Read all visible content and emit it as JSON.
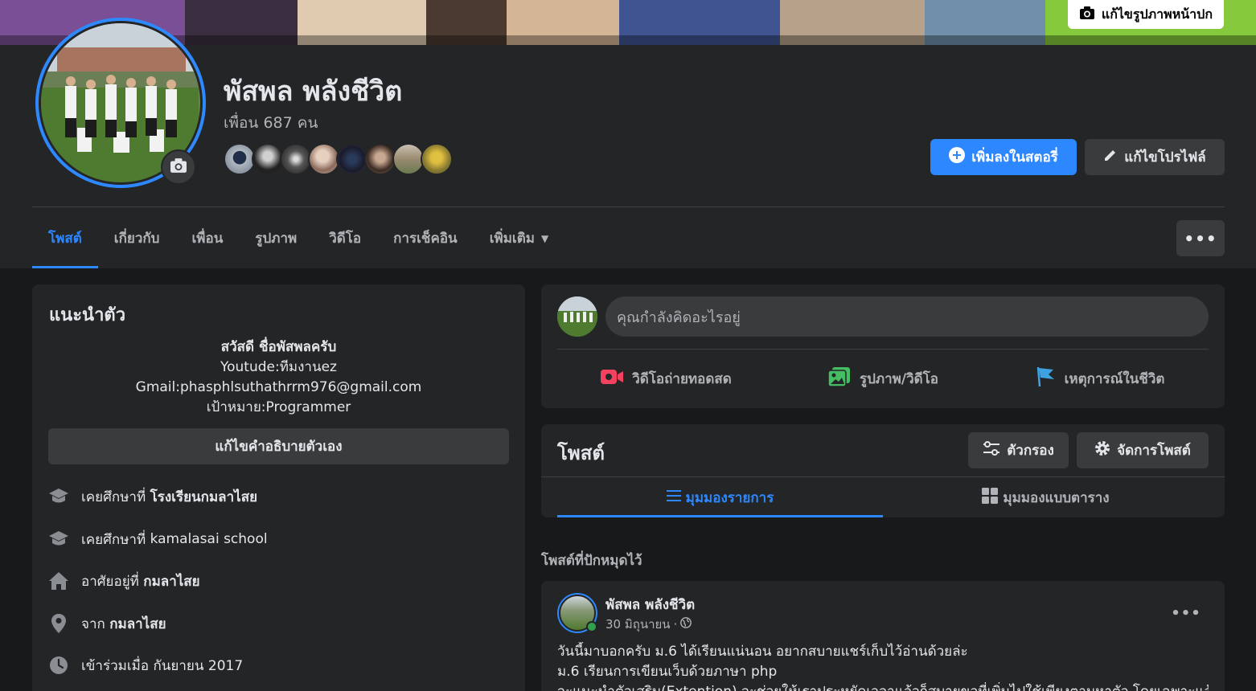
{
  "cover": {
    "edit_label": "แก้ไขรูปภาพหน้าปก"
  },
  "profile": {
    "name": "พัสพล พลังชีวิต",
    "friends_count": "เพื่อน 687 คน",
    "add_story_label": "เพิ่มลงในสตอรี่",
    "edit_profile_label": "แก้ไขโปรไฟล์"
  },
  "tabs": [
    {
      "label": "โพสต์"
    },
    {
      "label": "เกี่ยวกับ"
    },
    {
      "label": "เพื่อน"
    },
    {
      "label": "รูปภาพ"
    },
    {
      "label": "วิดีโอ"
    },
    {
      "label": "การเช็คอิน"
    },
    {
      "label": "เพิ่มเติม"
    }
  ],
  "intro": {
    "title": "แนะนำตัว",
    "bio": [
      "สวัสดี ชื่อพัสพลครับ",
      "Youtude:ทีมงานez",
      "Gmail:phasphlsuthathrrm976@gmail.com",
      "เป้าหมาย:Programmer"
    ],
    "edit_bio_label": "แก้ไขคำอธิบายตัวเอง",
    "items": [
      {
        "icon": "graduation-cap-icon",
        "prefix": "เคยศึกษาที่",
        "value": "โรงเรียนกมลาไสย"
      },
      {
        "icon": "graduation-cap-icon",
        "prefix": "เคยศึกษาที่",
        "value": "kamalasai school"
      },
      {
        "icon": "home-icon",
        "prefix": "อาศัยอยู่ที่",
        "value": "กมลาไสย"
      },
      {
        "icon": "location-pin-icon",
        "prefix": "จาก",
        "value": "กมลาไสย"
      },
      {
        "icon": "clock-icon",
        "prefix": "เข้าร่วมเมื่อ",
        "value": "กันยายน 2017"
      }
    ]
  },
  "composer": {
    "placeholder": "คุณกำลังคิดอะไรอยู่",
    "actions": [
      {
        "label": "วิดีโอถ่ายทอดสด",
        "icon": "live-video-icon",
        "color": "#f3425f"
      },
      {
        "label": "รูปภาพ/วิดีโอ",
        "icon": "photo-video-icon",
        "color": "#45bd62"
      },
      {
        "label": "เหตุการณ์ในชีวิต",
        "icon": "life-event-flag-icon",
        "color": "#3ea2e0"
      }
    ]
  },
  "posts": {
    "title": "โพสต์",
    "filter_label": "ตัวกรอง",
    "manage_label": "จัดการโพสต์",
    "list_view_label": "มุมมองรายการ",
    "grid_view_label": "มุมมองแบบตาราง"
  },
  "pinned": {
    "label": "โพสต์ที่ปักหมุดไว้"
  },
  "post": {
    "author": "พัสพล พลังชีวิต",
    "date": "30 มิถุนายน",
    "separator": "·",
    "lines": [
      "วันนี้มาบอกครับ ม.6 ได้เรียนแน่นอน อยากสบายแชร์เก็บไว้อ่านด้วยล่ะ",
      "ม.6 เรียนการเขียนเว็บด้วยภาษา php",
      "จะแนะนำตัวเสริม(Extention) จะช่วยให้เราประหยัดเวลาแล้วก็สบายขอที่เพิ่มไปใช้เพียงตามหาตัว โดยเฉพาะแล้ว"
    ]
  },
  "colors": {
    "accent": "#2d88ff",
    "background": "#18191a",
    "card": "#242526",
    "button": "#3a3b3c"
  }
}
